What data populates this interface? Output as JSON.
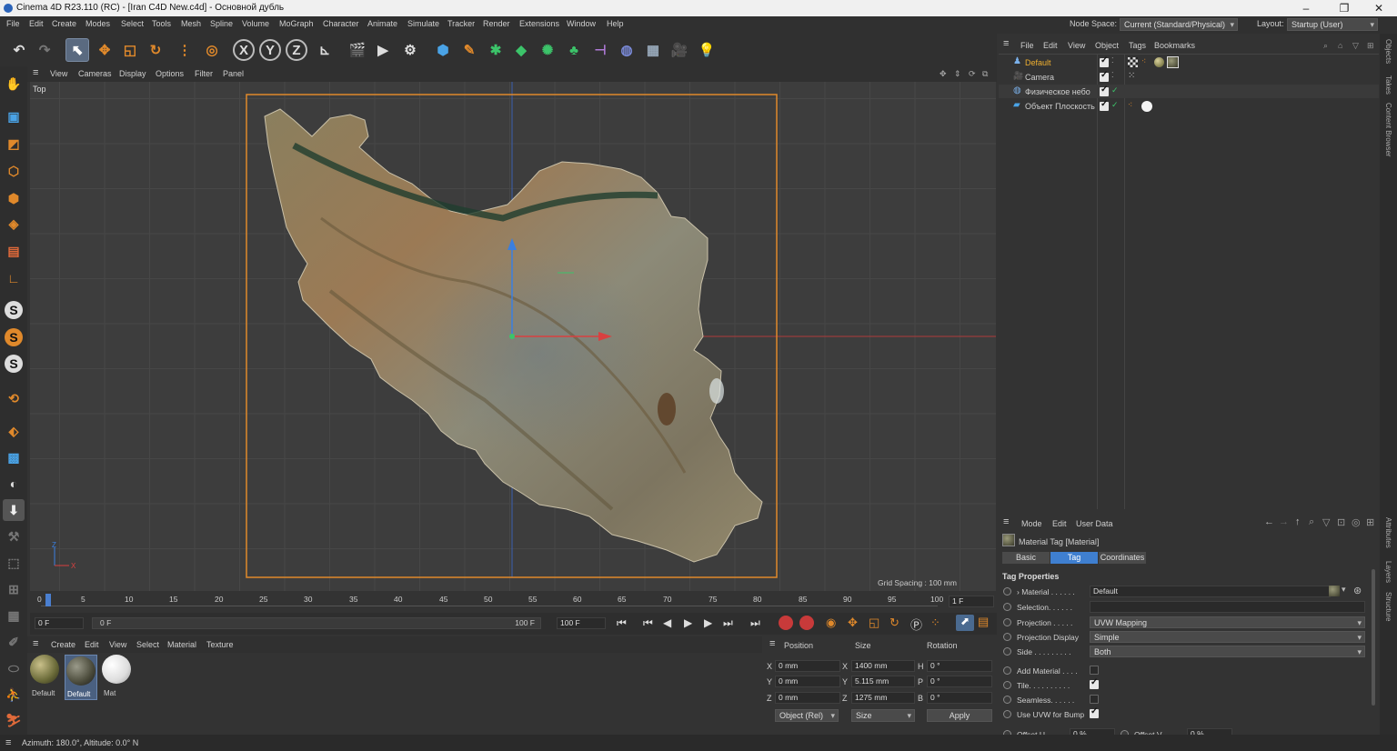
{
  "window": {
    "title": "Cinema 4D R23.110 (RC) - [Iran C4D New.c4d] - Основной дубль",
    "minimize": "–",
    "maximize": "❐",
    "close": "✕"
  },
  "menubar": {
    "items": [
      "File",
      "Edit",
      "Create",
      "Modes",
      "Select",
      "Tools",
      "Mesh",
      "Spline",
      "Volume",
      "MoGraph",
      "Character",
      "Animate",
      "Simulate",
      "Tracker",
      "Render",
      "Extensions",
      "Window",
      "Help"
    ],
    "node_space_label": "Node Space:",
    "node_space_value": "Current (Standard/Physical)",
    "layout_label": "Layout:",
    "layout_value": "Startup (User)"
  },
  "toolbar": {
    "axis_x": "X",
    "axis_y": "Y",
    "axis_z": "Z"
  },
  "lefttools": {
    "s1": "S",
    "s2": "S",
    "s3": "S"
  },
  "viewport_menu": {
    "items": [
      "View",
      "Cameras",
      "Display",
      "Options",
      "Filter",
      "Panel"
    ]
  },
  "viewport": {
    "view_name": "Top",
    "grid_spacing": "Grid Spacing : 100 mm",
    "axis_z": "Z",
    "axis_x": "X"
  },
  "timeline": {
    "ticks": [
      "0",
      "5",
      "10",
      "15",
      "20",
      "25",
      "30",
      "35",
      "40",
      "45",
      "50",
      "55",
      "60",
      "65",
      "70",
      "75",
      "80",
      "85",
      "90",
      "95",
      "100"
    ],
    "current_frame_field": "1 F"
  },
  "framebar": {
    "start": "0 F",
    "current": "0 F",
    "end_inner": "100 F",
    "end": "100 F"
  },
  "material_manager": {
    "menu": [
      "Create",
      "Edit",
      "View",
      "Select",
      "Material",
      "Texture"
    ],
    "materials": [
      {
        "name": "Default"
      },
      {
        "name": "Default"
      },
      {
        "name": "Mat"
      }
    ]
  },
  "coordinates": {
    "headers": {
      "position": "Position",
      "size": "Size",
      "rotation": "Rotation"
    },
    "rows": [
      {
        "axis": "X",
        "pos": "0 mm",
        "size_axis": "X",
        "size": "1400 mm",
        "rot_axis": "H",
        "rot": "0 °"
      },
      {
        "axis": "Y",
        "pos": "0 mm",
        "size_axis": "Y",
        "size": "5.115 mm",
        "rot_axis": "P",
        "rot": "0 °"
      },
      {
        "axis": "Z",
        "pos": "0 mm",
        "size_axis": "Z",
        "size": "1275 mm",
        "rot_axis": "B",
        "rot": "0 °"
      }
    ],
    "mode_select": "Object (Rel)",
    "size_select": "Size",
    "apply": "Apply"
  },
  "object_manager": {
    "menu": [
      "File",
      "Edit",
      "View",
      "Object",
      "Tags",
      "Bookmarks"
    ],
    "objects": [
      {
        "name": "Default"
      },
      {
        "name": "Camera"
      },
      {
        "name": "Физическое небо"
      },
      {
        "name": "Объект Плоскость"
      }
    ]
  },
  "attribute_manager": {
    "menu": [
      "Mode",
      "Edit",
      "User Data"
    ],
    "title": "Material Tag [Material]",
    "tabs": [
      "Basic",
      "Tag",
      "Coordinates"
    ],
    "active_tab": "Tag",
    "section": "Tag Properties",
    "props": {
      "material_label": "Material . . . . . .",
      "material_value": "Default",
      "selection_label": "Selection. . . . . .",
      "projection_label": "Projection . . . . .",
      "projection_value": "UVW Mapping",
      "projection_display_label": "Projection Display",
      "projection_display_value": "Simple",
      "side_label": "Side . . . . . . . . .",
      "side_value": "Both",
      "add_material_label": "Add Material . . . .",
      "tile_label": "Tile. . . . . . . . . .",
      "seamless_label": "Seamless. . . . . .",
      "uvw_bump_label": "Use UVW for Bump",
      "offset_u_label": "Offset U . . . . .",
      "offset_u_value": "0 %",
      "offset_v_label": "Offset V . . . .",
      "offset_v_value": "0 %"
    }
  },
  "right_strip": {
    "tabs": [
      "Objects",
      "Takes",
      "Content Browser",
      "Attributes",
      "Layers",
      "Structure"
    ]
  },
  "statusbar": {
    "text": "Azimuth: 180.0°, Altitude: 0.0°  N"
  },
  "colors": {
    "accent": "#3f7fd0",
    "selection_orange": "#e0892b",
    "bg": "#333333"
  }
}
